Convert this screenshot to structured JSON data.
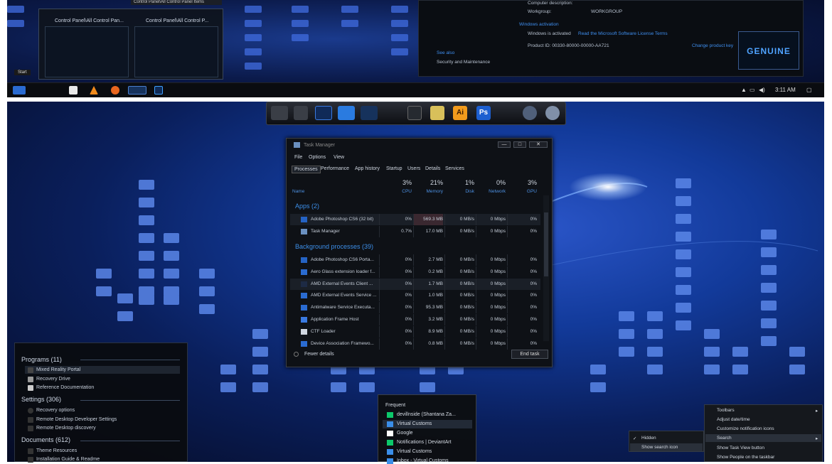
{
  "top": {
    "tooltip": "Control Panel\\All Control Panel Items",
    "thumbs": [
      "Control Panel\\All Control Pan...",
      "Control Panel\\All Control P..."
    ],
    "start_label": "Start",
    "system": {
      "computer_description": "Computer description:",
      "workgroup_label": "Workgroup:",
      "workgroup_value": "WORKGROUP",
      "activation_heading": "Windows activation",
      "activated": "Windows is activated",
      "license_link": "Read the Microsoft Software License Terms",
      "product_id": "Product ID: 00330-80000-00000-AA721",
      "change_key": "Change product key",
      "see_also": "See also",
      "security": "Security and Maintenance",
      "genuine": "GENUINE"
    },
    "taskbar": {
      "time": "3:11 AM"
    }
  },
  "dock": {
    "ai": "Ai",
    "ps": "Ps"
  },
  "taskmanager": {
    "title": "Task Manager",
    "menu": [
      "File",
      "Options",
      "View"
    ],
    "tabs": [
      "Processes",
      "Performance",
      "App history",
      "Startup",
      "Users",
      "Details",
      "Services"
    ],
    "col_name": "Name",
    "cols": [
      {
        "pct": "3%",
        "label": "CPU"
      },
      {
        "pct": "21%",
        "label": "Memory"
      },
      {
        "pct": "1%",
        "label": "Disk"
      },
      {
        "pct": "0%",
        "label": "Network"
      },
      {
        "pct": "3%",
        "label": "GPU"
      }
    ],
    "group_apps": "Apps (2)",
    "group_bg": "Background processes (39)",
    "apps": [
      {
        "name": "Adobe Photoshop CS6 (32 bit)",
        "cpu": "0%",
        "mem": "569.3 MB",
        "disk": "0 MB/s",
        "net": "0 Mbps",
        "gpu": "0%"
      },
      {
        "name": "Task Manager",
        "cpu": "0.7%",
        "mem": "17.0 MB",
        "disk": "0 MB/s",
        "net": "0 Mbps",
        "gpu": "0%"
      }
    ],
    "bg": [
      {
        "name": "Adobe Photoshop CS6 Porta...",
        "cpu": "0%",
        "mem": "2.7 MB",
        "disk": "0 MB/s",
        "net": "0 Mbps",
        "gpu": "0%"
      },
      {
        "name": "Aero Glass extension loader f...",
        "cpu": "0%",
        "mem": "0.2 MB",
        "disk": "0 MB/s",
        "net": "0 Mbps",
        "gpu": "0%"
      },
      {
        "name": "AMD External Events Client ...",
        "cpu": "0%",
        "mem": "1.7 MB",
        "disk": "0 MB/s",
        "net": "0 Mbps",
        "gpu": "0%"
      },
      {
        "name": "AMD External Events Service ...",
        "cpu": "0%",
        "mem": "1.0 MB",
        "disk": "0 MB/s",
        "net": "0 Mbps",
        "gpu": "0%"
      },
      {
        "name": "Antimalware Service Executa...",
        "cpu": "0%",
        "mem": "95.3 MB",
        "disk": "0 MB/s",
        "net": "0 Mbps",
        "gpu": "0%"
      },
      {
        "name": "Application Frame Host",
        "cpu": "0%",
        "mem": "3.2 MB",
        "disk": "0 MB/s",
        "net": "0 Mbps",
        "gpu": "0%"
      },
      {
        "name": "CTF Loader",
        "cpu": "0%",
        "mem": "8.9 MB",
        "disk": "0 MB/s",
        "net": "0 Mbps",
        "gpu": "0%"
      },
      {
        "name": "Device Association Framewo...",
        "cpu": "0%",
        "mem": "0.8 MB",
        "disk": "0 MB/s",
        "net": "0 Mbps",
        "gpu": "0%"
      }
    ],
    "fewer": "Fewer details",
    "end_task": "End task"
  },
  "startmenu": {
    "programs": "Programs (11)",
    "program_items": [
      "Mixed Reality Portal",
      "Recovery Drive",
      "Reference Documentation"
    ],
    "settings": "Settings (306)",
    "settings_items": [
      "Recovery options",
      "Remote Desktop Developer Settings",
      "Remote Desktop discovery"
    ],
    "documents": "Documents (612)",
    "document_items": [
      "Theme Resources",
      "Installation Guide & Readme"
    ]
  },
  "jumplist": {
    "heading": "Frequent",
    "items": [
      "devillnside (Shantana Za...",
      "Virtual Customs",
      "Google",
      "Notifications | DeviantArt",
      "Virtual Customs",
      "Inbox - Virtual Customs"
    ]
  },
  "ctx_small": [
    "Hidden",
    "Show search icon"
  ],
  "ctx": [
    "Toolbars",
    "Adjust date/time",
    "Customize notification icons",
    "Search",
    "Show Task View button",
    "Show People on the taskbar"
  ]
}
